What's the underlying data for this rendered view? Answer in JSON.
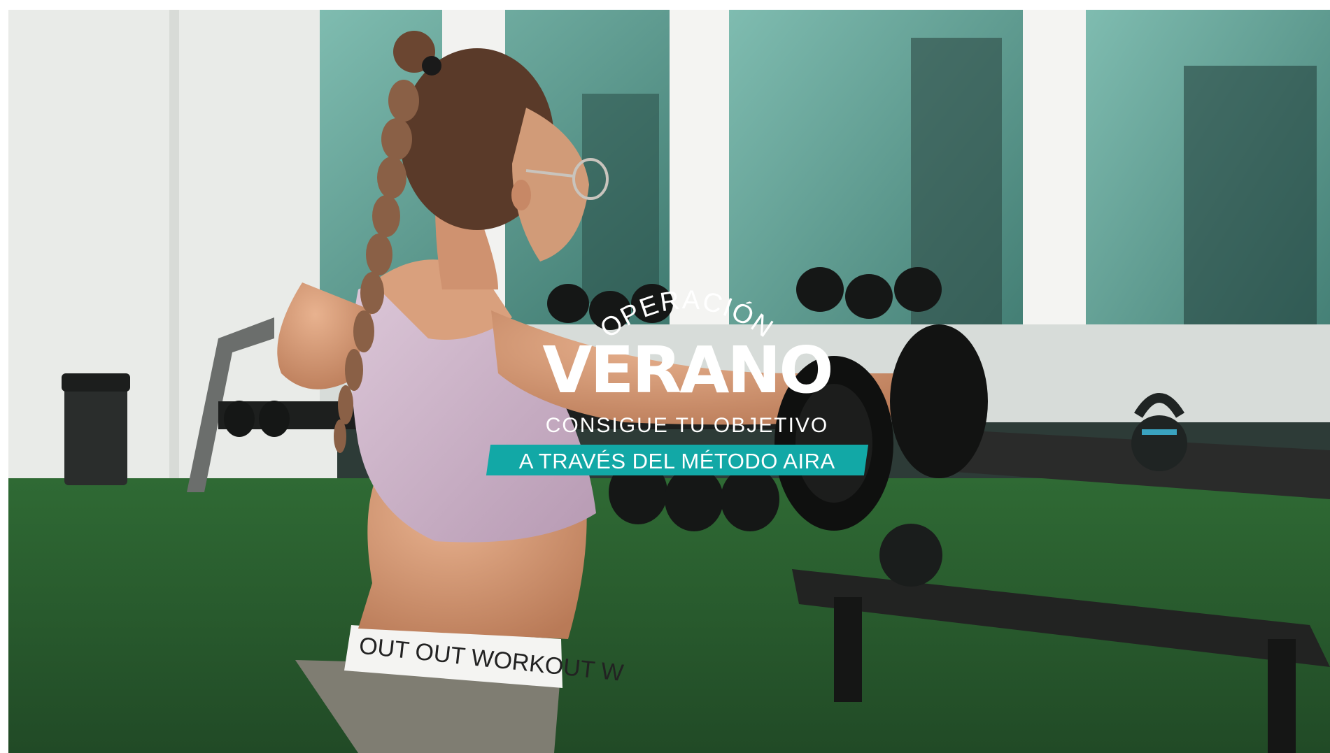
{
  "hero": {
    "arc_text": "OPERACIÓN",
    "title": "VERANO",
    "subtitle": "CONSIGUE  TU OBJETIVO",
    "ribbon_text": "A TRAVÉS DEL MÉTODO AIRA",
    "waistband_text": "OUT OUT WORKOUT W"
  },
  "colors": {
    "accent": "#12a8a6",
    "text": "#ffffff",
    "turf": "#2c5a2c",
    "glass": "#5e9e92"
  }
}
